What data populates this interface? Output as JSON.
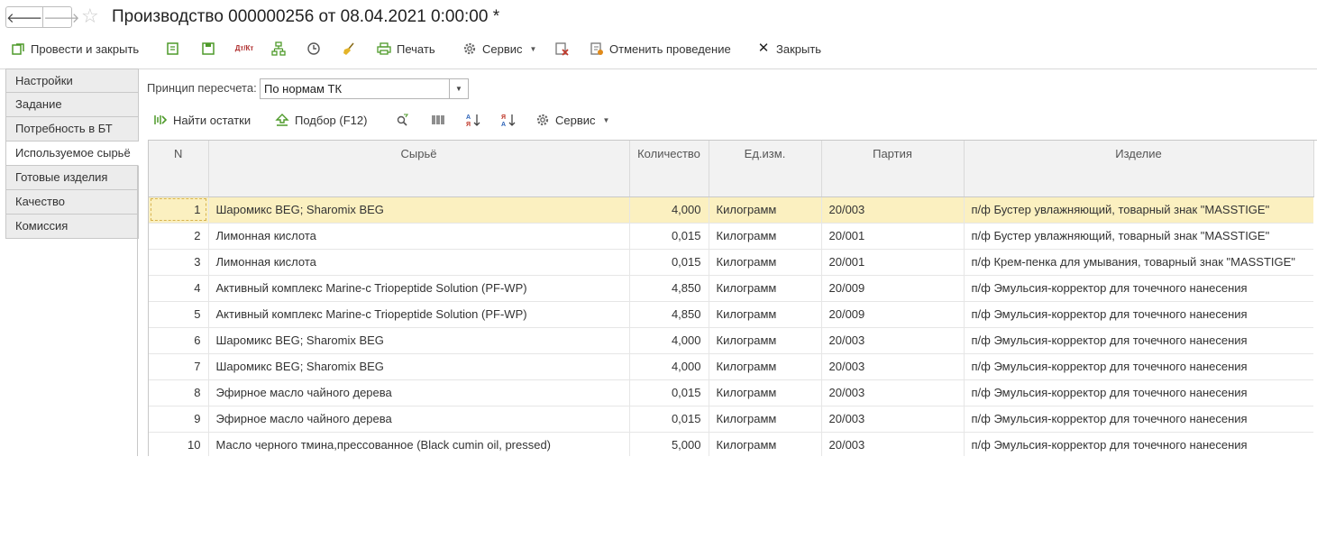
{
  "window": {
    "title": "Производство 000000256 от 08.04.2021 0:00:00 *",
    "back_glyph": "🡐",
    "forward_glyph": "🡒",
    "star_glyph": "☆"
  },
  "toolbar": {
    "post_close": "Провести и закрыть",
    "print": "Печать",
    "service": "Сервис",
    "cancel_posting": "Отменить проведение",
    "close": "Закрыть",
    "dtkt_icon_text": "Дт/Кт"
  },
  "sidebar": {
    "tabs": [
      {
        "label": "Настройки"
      },
      {
        "label": "Задание"
      },
      {
        "label": "Потребность в БТ"
      },
      {
        "label": "Используемое сырьё"
      },
      {
        "label": "Готовые изделия"
      },
      {
        "label": "Качество"
      },
      {
        "label": "Комиссия"
      }
    ],
    "active_index": 3
  },
  "recalc": {
    "label": "Принцип пересчета:",
    "value": "По нормам ТК"
  },
  "table_toolbar": {
    "find_rest": "Найти остатки",
    "pick": "Подбор (F12)",
    "service": "Сервис"
  },
  "table": {
    "columns": [
      "N",
      "Сырьё",
      "Количество",
      "Ед.изм.",
      "Партия",
      "Изделие"
    ],
    "selected_row": 0,
    "rows": [
      {
        "n": "1",
        "material": "Шаромикс BEG; Sharomix BEG",
        "qty": "4,000",
        "unit": "Килограмм",
        "batch": "20/003",
        "product": "п/ф Бустер увлажняющий, товарный знак \"MASSTIGE\""
      },
      {
        "n": "2",
        "material": "Лимонная кислота",
        "qty": "0,015",
        "unit": "Килограмм",
        "batch": "20/001",
        "product": "п/ф Бустер увлажняющий, товарный знак \"MASSTIGE\""
      },
      {
        "n": "3",
        "material": "Лимонная кислота",
        "qty": "0,015",
        "unit": "Килограмм",
        "batch": "20/001",
        "product": "п/ф Крем-пенка для умывания, товарный знак \"MASSTIGE\""
      },
      {
        "n": "4",
        "material": "Активный комплекс Marine-c Triopeptide Solution (PF-WP)",
        "qty": "4,850",
        "unit": "Килограмм",
        "batch": "20/009",
        "product": "п/ф Эмульсия-корректор для точечного нанесения"
      },
      {
        "n": "5",
        "material": "Активный комплекс Marine-c Triopeptide Solution (PF-WP)",
        "qty": "4,850",
        "unit": "Килограмм",
        "batch": "20/009",
        "product": "п/ф Эмульсия-корректор для точечного нанесения"
      },
      {
        "n": "6",
        "material": "Шаромикс BEG; Sharomix BEG",
        "qty": "4,000",
        "unit": "Килограмм",
        "batch": "20/003",
        "product": "п/ф Эмульсия-корректор для точечного нанесения"
      },
      {
        "n": "7",
        "material": "Шаромикс BEG; Sharomix BEG",
        "qty": "4,000",
        "unit": "Килограмм",
        "batch": "20/003",
        "product": "п/ф Эмульсия-корректор для точечного нанесения"
      },
      {
        "n": "8",
        "material": "Эфирное масло чайного дерева",
        "qty": "0,015",
        "unit": "Килограмм",
        "batch": "20/003",
        "product": "п/ф Эмульсия-корректор для точечного нанесения"
      },
      {
        "n": "9",
        "material": "Эфирное масло чайного дерева",
        "qty": "0,015",
        "unit": "Килограмм",
        "batch": "20/003",
        "product": "п/ф Эмульсия-корректор для точечного нанесения"
      },
      {
        "n": "10",
        "material": "Масло черного тмина,прессованное (Black cumin oil, pressed)",
        "qty": "5,000",
        "unit": "Килограмм",
        "batch": "20/003",
        "product": "п/ф Эмульсия-корректор для точечного нанесения"
      }
    ]
  },
  "colors": {
    "selected_row": "#fbf0c0",
    "icon_green": "#4e9a2a",
    "icon_red": "#c0392b"
  }
}
